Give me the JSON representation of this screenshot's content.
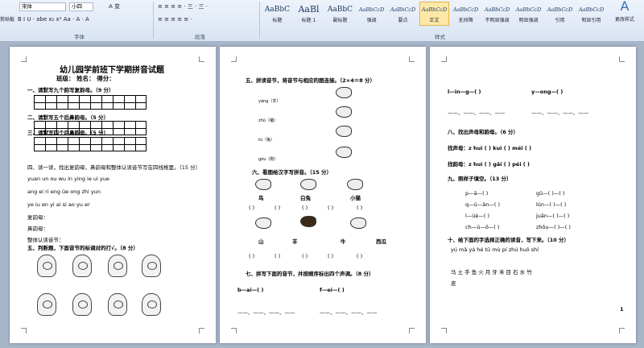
{
  "ribbon": {
    "font_name": "宋体",
    "font_size": "小四",
    "styles_edit": "A 变",
    "row2_tools": "B I U · abe x₂ x² Aa · A · A",
    "para_row1": "≡ ≡ ≡ ≡ · 三 · 三 ·",
    "para_row2": "≡ ≡ ≡ ≡ ≡ ·",
    "group_font": "字体",
    "group_para": "段落",
    "group_style": "样式",
    "cut_label": "剪贴板",
    "styles": [
      {
        "preview": "AaBbC",
        "name": "标题"
      },
      {
        "preview": "AaBl",
        "name": "标题 1"
      },
      {
        "preview": "AaBbC",
        "name": "副标题"
      },
      {
        "preview": "AaBbCcD",
        "name": "强调"
      },
      {
        "preview": "AaBbCcD",
        "name": "要点"
      },
      {
        "preview": "AaBbCcD",
        "name": "正文"
      },
      {
        "preview": "AaBbCcD",
        "name": "无间隔"
      },
      {
        "preview": "AaBbCcD",
        "name": "不明显强调"
      },
      {
        "preview": "AaBbCcD",
        "name": "明显强调"
      },
      {
        "preview": "AaBbCcD",
        "name": "引用"
      },
      {
        "preview": "AaBbCcD",
        "name": "明显引用"
      }
    ],
    "change_styles": "更改样式"
  },
  "page1": {
    "title": "幼儿园学前班下学期拼音试题",
    "info": "班级：     姓名：     得分：",
    "q1": "一、请默写九个韵写复韵母。（9 分）",
    "q2": "二、请默写五个后鼻韵母。（5 分）",
    "q3": "三、请默写四个后鼻韵母。（5 分）",
    "q4": "四、读一读，找出复韵母，鼻韵母和整体认读音节写在四线格里。（15 分）",
    "row1": "yuan  un  ou  wu  in  ying  ie  ui  yue",
    "row2": "ang  ei  ri  eng  üe  ong  zhi  yun",
    "row3": "ye  iu  en  yi  ai  si  ao  yu  er",
    "a1": "复韵母：",
    "a2": "鼻韵母：",
    "a3": "整体认读音节：",
    "q5": "五、判断题，下面音节的标调对的打√。（8 分）"
  },
  "page2": {
    "q5": "五、拼读音节，将音节与相应的图连接。（2×4＝8 分）",
    "w1": "yáng（羊）",
    "w2": "zhū（猪）",
    "w3": "tù（兔）",
    "w4": "gǒu（狗）",
    "q6": "六、看图给汉字写拼音。（15 分）",
    "n1": "鸟",
    "n2": "白兔",
    "n3": "小猫",
    "n4": "山",
    "n5": "羊",
    "n6": "牛",
    "n7": "西瓜",
    "paren": "(      )",
    "q7": "七、拼写下面的音节，并按顺序标出四个声调。（8 分）",
    "s1": "b—ai—(          )",
    "s2": "f—ei—(          )",
    "tone": "——、——、——、——"
  },
  "page3": {
    "s1": "l—in—g—(          )",
    "s2": "y—ong—(          )",
    "tone1": "——、——、——、——",
    "tone2": "——、——、——、——",
    "q8": "八、找出声母和韵母。（6 分）",
    "r1": "找声母：z huì  (      )      kuì  (      )      méi  (      )",
    "r2": "找韵母：z huì  (      )      gāi  (      )      péi  (      )",
    "q9": "九、照样子填空。（13 分）",
    "f1": "p—ā—(     )",
    "f2": "q—ū—ǎn—(     )",
    "f3": "l—üè—(     )",
    "f4": "ch—ū—ō—(     )",
    "g1": "gǔ—(     )—(     )",
    "g2": "lún—(     )—(     )",
    "g3": "juǎn—(     )—(     )",
    "g4": "zhōu—(     )—(     )",
    "q10": "十、给下面的字选择正确的读音，写下来。（10 分）",
    "py": "yú   mǎ   yá   hé   tǔ   mù   pí   zhú   huǒ   shí",
    "hz": "马   土   手   鱼   火   月   牙   禾   目   石   水   竹",
    "last": "皮",
    "page_no": "1"
  }
}
